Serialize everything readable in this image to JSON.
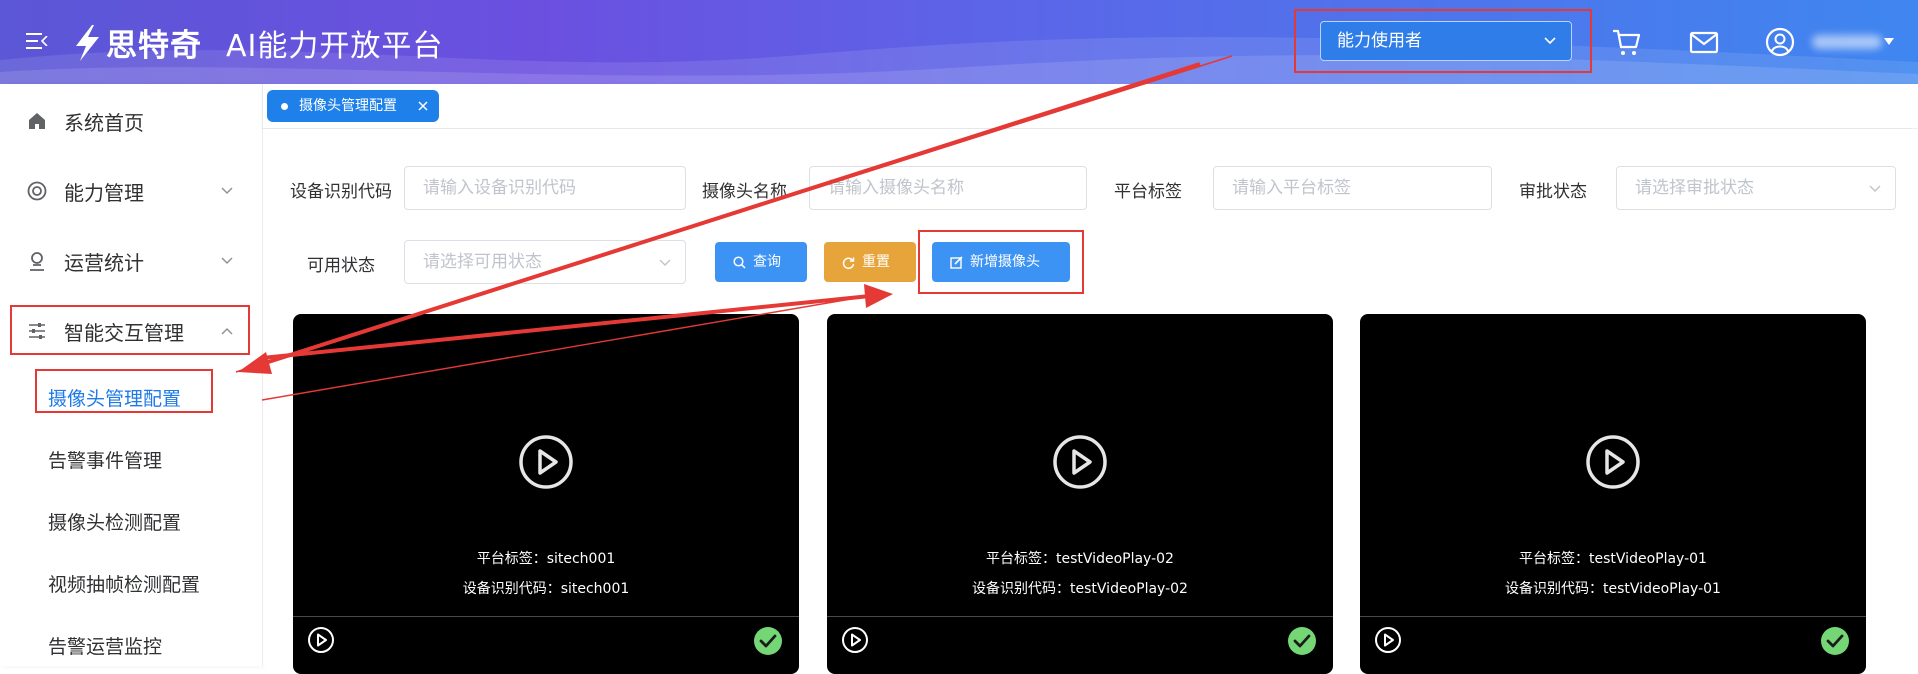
{
  "header": {
    "logo_text": "思特奇",
    "platform_title": "AI能力开放平台",
    "role_select": "能力使用者",
    "icons": [
      "menu-icon",
      "cart-icon",
      "mail-icon",
      "user-icon",
      "chevron-down-icon"
    ],
    "gradient_colors": [
      "#5b57d6",
      "#6b50e0",
      "#3f86f0"
    ]
  },
  "sidebar": {
    "items": [
      {
        "label": "系统首页",
        "icon": "home-icon"
      },
      {
        "label": "能力管理",
        "icon": "capability-icon"
      },
      {
        "label": "运营统计",
        "icon": "stats-icon"
      },
      {
        "label": "智能交互管理",
        "icon": "sliders-icon"
      }
    ],
    "sub_items": [
      "摄像头管理配置",
      "告警事件管理",
      "摄像头检测配置",
      "视频抽帧检测配置",
      "告警运营监控"
    ],
    "active_color": "#1f7ae8"
  },
  "tabs": [
    {
      "label": "摄像头管理配置"
    }
  ],
  "filters": {
    "device_code": {
      "label": "设备识别代码",
      "placeholder": "请输入设备识别代码"
    },
    "camera_name": {
      "label": "摄像头名称",
      "placeholder": "请输入摄像头名称"
    },
    "platform_tag": {
      "label": "平台标签",
      "placeholder": "请输入平台标签"
    },
    "approval_status": {
      "label": "审批状态",
      "placeholder": "请选择审批状态"
    },
    "available_status": {
      "label": "可用状态",
      "placeholder": "请选择可用状态"
    }
  },
  "buttons": {
    "query": "查询",
    "reset": "重置",
    "add": "新增摄像头"
  },
  "cards": [
    {
      "platform_line": "平台标签：sitech001",
      "code_line": "设备识别代码：sitech001"
    },
    {
      "platform_line": "平台标签：testVideoPlay-02",
      "code_line": "设备识别代码：testVideoPlay-02"
    },
    {
      "platform_line": "平台标签：testVideoPlay-01",
      "code_line": "设备识别代码：testVideoPlay-01"
    }
  ],
  "colors": {
    "primary": "#3d93f4",
    "warning": "#e7a43a",
    "success": "#74d675",
    "annotation": "#e53935"
  }
}
